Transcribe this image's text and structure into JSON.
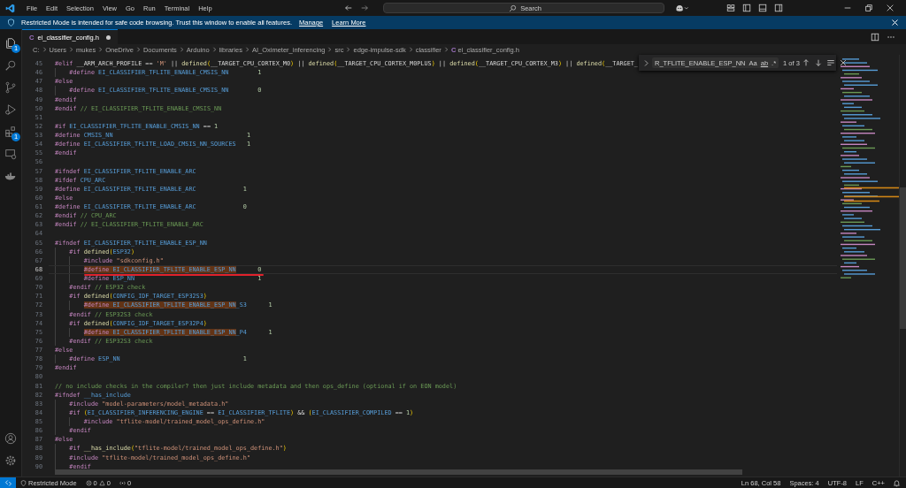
{
  "titlebar": {
    "menu": [
      "File",
      "Edit",
      "Selection",
      "View",
      "Go",
      "Run",
      "Terminal",
      "Help"
    ],
    "search": {
      "placeholder": "Search"
    }
  },
  "banner": {
    "message": "Restricted Mode is intended for safe code browsing. Trust this window to enable all features.",
    "links": [
      "Manage",
      "Learn More"
    ]
  },
  "activity_bar": {
    "items": [
      {
        "kind": "files",
        "badge": "1"
      },
      {
        "kind": "search"
      },
      {
        "kind": "branch"
      },
      {
        "kind": "run"
      },
      {
        "kind": "extensions",
        "badge": "1"
      },
      {
        "kind": "remote"
      },
      {
        "kind": "docker"
      }
    ],
    "bottom": [
      {
        "kind": "account"
      },
      {
        "kind": "settings"
      }
    ]
  },
  "tabs": [
    {
      "icon": "C",
      "label": "ei_classifier_config.h",
      "selected": true,
      "modified": true
    }
  ],
  "breadcrumb": {
    "segments": [
      "C:",
      "Users",
      "mukes",
      "OneDrive",
      "Documents",
      "Arduino",
      "libraries",
      "AI_Oximeter_inferencing",
      "src",
      "edge-impulse-sdk",
      "classifier"
    ],
    "file_icon": "C",
    "file": "ei_classifier_config.h"
  },
  "find": {
    "value": "R_TFLITE_ENABLE_ESP_NN",
    "options": [
      "Aa",
      "ab",
      ".*"
    ],
    "count": "1 of 3"
  },
  "editor": {
    "lines": [
      {
        "number": "45",
        "current": false,
        "underlined": false,
        "tokens": [
          {
            "kind": "pp",
            "text": "#elif"
          },
          {
            "kind": "op",
            "text": " __ARM_ARCH_PROFILE == "
          },
          {
            "kind": "str",
            "text": "'M'"
          },
          {
            "kind": "op",
            "text": " || "
          },
          {
            "kind": "fn",
            "text": "defined"
          },
          {
            "kind": "br",
            "text": "("
          },
          {
            "kind": "op",
            "text": "__TARGET_CPU_CORTEX_M0"
          },
          {
            "kind": "br",
            "text": ")"
          },
          {
            "kind": "op",
            "text": " || "
          },
          {
            "kind": "fn",
            "text": "defined"
          },
          {
            "kind": "br",
            "text": "("
          },
          {
            "kind": "op",
            "text": "__TARGET_CPU_CORTEX_M0PLUS"
          },
          {
            "kind": "br",
            "text": ")"
          },
          {
            "kind": "op",
            "text": " || "
          },
          {
            "kind": "fn",
            "text": "defined"
          },
          {
            "kind": "br",
            "text": "("
          },
          {
            "kind": "op",
            "text": "__TARGET_CPU_CORTEX_M3"
          },
          {
            "kind": "br",
            "text": ")"
          },
          {
            "kind": "op",
            "text": " || "
          },
          {
            "kind": "fn",
            "text": "defined"
          },
          {
            "kind": "br",
            "text": "("
          },
          {
            "kind": "op",
            "text": "__TARGET_"
          }
        ]
      },
      {
        "number": "46",
        "current": false,
        "underlined": false,
        "tokens": [
          {
            "kind": "pp",
            "text": "    #define"
          },
          {
            "kind": "id",
            "text": " EI_CLASSIFIER_TFLITE_ENABLE_CMSIS_NN"
          },
          {
            "kind": "num",
            "text": "        1"
          }
        ]
      },
      {
        "number": "47",
        "current": false,
        "underlined": false,
        "tokens": [
          {
            "kind": "pp",
            "text": "#else"
          }
        ]
      },
      {
        "number": "48",
        "current": false,
        "underlined": false,
        "tokens": [
          {
            "kind": "pp",
            "text": "    #define"
          },
          {
            "kind": "id",
            "text": " EI_CLASSIFIER_TFLITE_ENABLE_CMSIS_NN"
          },
          {
            "kind": "num",
            "text": "        0"
          }
        ]
      },
      {
        "number": "49",
        "current": false,
        "underlined": false,
        "tokens": [
          {
            "kind": "pp",
            "text": "#endif"
          }
        ]
      },
      {
        "number": "50",
        "current": false,
        "underlined": false,
        "tokens": [
          {
            "kind": "pp",
            "text": "#endif"
          },
          {
            "kind": "com",
            "text": " // EI_CLASSIFIER_TFLITE_ENABLE_CMSIS_NN"
          }
        ]
      },
      {
        "number": "51",
        "current": false,
        "underlined": false
      },
      {
        "number": "52",
        "current": false,
        "underlined": false,
        "tokens": [
          {
            "kind": "pp",
            "text": "#if"
          },
          {
            "kind": "id",
            "text": " EI_CLASSIFIER_TFLITE_ENABLE_CMSIS_NN"
          },
          {
            "kind": "op",
            "text": " == "
          },
          {
            "kind": "num",
            "text": "1"
          }
        ]
      },
      {
        "number": "53",
        "current": false,
        "underlined": false,
        "tokens": [
          {
            "kind": "pp",
            "text": "#define"
          },
          {
            "kind": "id",
            "text": " CMSIS_NN"
          },
          {
            "kind": "num",
            "text": "                                     1"
          }
        ]
      },
      {
        "number": "54",
        "current": false,
        "underlined": false,
        "tokens": [
          {
            "kind": "pp",
            "text": "#define"
          },
          {
            "kind": "id",
            "text": " EI_CLASSIFIER_TFLITE_LOAD_CMSIS_NN_SOURCES"
          },
          {
            "kind": "num",
            "text": "   1"
          }
        ]
      },
      {
        "number": "55",
        "current": false,
        "underlined": false,
        "tokens": [
          {
            "kind": "pp",
            "text": "#endif"
          }
        ]
      },
      {
        "number": "56",
        "current": false,
        "underlined": false
      },
      {
        "number": "57",
        "current": false,
        "underlined": false,
        "tokens": [
          {
            "kind": "pp",
            "text": "#ifndef"
          },
          {
            "kind": "id",
            "text": " EI_CLASSIFIER_TFLITE_ENABLE_ARC"
          }
        ]
      },
      {
        "number": "58",
        "current": false,
        "underlined": false,
        "tokens": [
          {
            "kind": "pp",
            "text": "#ifdef"
          },
          {
            "kind": "id",
            "text": " CPU_ARC"
          }
        ]
      },
      {
        "number": "59",
        "current": false,
        "underlined": false,
        "tokens": [
          {
            "kind": "pp",
            "text": "#define"
          },
          {
            "kind": "id",
            "text": " EI_CLASSIFIER_TFLITE_ENABLE_ARC"
          },
          {
            "kind": "num",
            "text": "             1"
          }
        ]
      },
      {
        "number": "60",
        "current": false,
        "underlined": false,
        "tokens": [
          {
            "kind": "pp",
            "text": "#else"
          }
        ]
      },
      {
        "number": "61",
        "current": false,
        "underlined": false,
        "tokens": [
          {
            "kind": "pp",
            "text": "#define"
          },
          {
            "kind": "id",
            "text": " EI_CLASSIFIER_TFLITE_ENABLE_ARC"
          },
          {
            "kind": "num",
            "text": "             0"
          }
        ]
      },
      {
        "number": "62",
        "current": false,
        "underlined": false,
        "tokens": [
          {
            "kind": "pp",
            "text": "#endif"
          },
          {
            "kind": "com",
            "text": " // CPU_ARC"
          }
        ]
      },
      {
        "number": "63",
        "current": false,
        "underlined": false,
        "tokens": [
          {
            "kind": "pp",
            "text": "#endif"
          },
          {
            "kind": "com",
            "text": " // EI_CLASSIFIER_TFLITE_ENABLE_ARC"
          }
        ]
      },
      {
        "number": "64",
        "current": false,
        "underlined": false
      },
      {
        "number": "65",
        "current": false,
        "underlined": false,
        "tokens": [
          {
            "kind": "pp",
            "text": "#ifndef"
          },
          {
            "kind": "id",
            "text": " EI_CLASSIFIER_TFLITE_ENABLE_ESP_NN"
          }
        ]
      },
      {
        "number": "66",
        "current": false,
        "underlined": false,
        "tokens": [
          {
            "kind": "pp",
            "text": "    #if "
          },
          {
            "kind": "fn",
            "text": "defined"
          },
          {
            "kind": "br",
            "text": "("
          },
          {
            "kind": "id",
            "text": "ESP32"
          },
          {
            "kind": "br",
            "text": ")"
          }
        ]
      },
      {
        "number": "67",
        "current": false,
        "underlined": false,
        "tokens": [
          {
            "kind": "pp",
            "text": "        #include"
          },
          {
            "kind": "str",
            "text": " \"sdkconfig.h\""
          }
        ]
      },
      {
        "number": "68",
        "current": true,
        "underlined": true,
        "tokens": [
          {
            "kind": "hitpp",
            "text": "        #define"
          },
          {
            "kind": "hitid",
            "text": " EI_CLASSIFIER_TFLITE_ENABLE_ESP_NN"
          },
          {
            "kind": "num",
            "text": "      0"
          }
        ]
      },
      {
        "number": "69",
        "current": false,
        "underlined": false,
        "tokens": [
          {
            "kind": "pp",
            "text": "        #define"
          },
          {
            "kind": "id",
            "text": " ESP_NN"
          },
          {
            "kind": "num",
            "text": "                                  1"
          }
        ]
      },
      {
        "number": "70",
        "current": false,
        "underlined": false,
        "tokens": [
          {
            "kind": "pp",
            "text": "    #endif"
          },
          {
            "kind": "com",
            "text": " // ESP32 check"
          }
        ]
      },
      {
        "number": "71",
        "current": false,
        "underlined": false,
        "tokens": [
          {
            "kind": "pp",
            "text": "    #if "
          },
          {
            "kind": "fn",
            "text": "defined"
          },
          {
            "kind": "br",
            "text": "("
          },
          {
            "kind": "id",
            "text": "CONFIG_IDF_TARGET_ESP32S3"
          },
          {
            "kind": "br",
            "text": ")"
          }
        ]
      },
      {
        "number": "72",
        "current": false,
        "underlined": false,
        "tokens": [
          {
            "kind": "hitpp",
            "text": "        #define"
          },
          {
            "kind": "hitid",
            "text": " EI_CLASSIFIER_TFLITE_ENABLE_ESP_NN"
          },
          {
            "kind": "id",
            "text": "_S3"
          },
          {
            "kind": "num",
            "text": "      1"
          }
        ]
      },
      {
        "number": "73",
        "current": false,
        "underlined": false,
        "tokens": [
          {
            "kind": "pp",
            "text": "    #endif"
          },
          {
            "kind": "com",
            "text": " // ESP32S3 check"
          }
        ]
      },
      {
        "number": "74",
        "current": false,
        "underlined": false,
        "tokens": [
          {
            "kind": "pp",
            "text": "    #if "
          },
          {
            "kind": "fn",
            "text": "defined"
          },
          {
            "kind": "br",
            "text": "("
          },
          {
            "kind": "id",
            "text": "CONFIG_IDF_TARGET_ESP32P4"
          },
          {
            "kind": "br",
            "text": ")"
          }
        ]
      },
      {
        "number": "75",
        "current": false,
        "underlined": false,
        "tokens": [
          {
            "kind": "hitpp",
            "text": "        #define"
          },
          {
            "kind": "hitid",
            "text": " EI_CLASSIFIER_TFLITE_ENABLE_ESP_NN"
          },
          {
            "kind": "id",
            "text": "_P4"
          },
          {
            "kind": "num",
            "text": "      1"
          }
        ]
      },
      {
        "number": "76",
        "current": false,
        "underlined": false,
        "tokens": [
          {
            "kind": "pp",
            "text": "    #endif"
          },
          {
            "kind": "com",
            "text": " // ESP32S3 check"
          }
        ]
      },
      {
        "number": "77",
        "current": false,
        "underlined": false,
        "tokens": [
          {
            "kind": "pp",
            "text": "#else"
          }
        ]
      },
      {
        "number": "78",
        "current": false,
        "underlined": false,
        "tokens": [
          {
            "kind": "pp",
            "text": "    #define"
          },
          {
            "kind": "id",
            "text": " ESP_NN"
          },
          {
            "kind": "num",
            "text": "                                  1"
          }
        ]
      },
      {
        "number": "79",
        "current": false,
        "underlined": false,
        "tokens": [
          {
            "kind": "pp",
            "text": "#endif"
          }
        ]
      },
      {
        "number": "80",
        "current": false,
        "underlined": false
      },
      {
        "number": "81",
        "current": false,
        "underlined": false,
        "tokens": [
          {
            "kind": "com",
            "text": "// no include checks in the compiler? then just include metadata and then ops_define (optional if on EON model)"
          }
        ]
      },
      {
        "number": "82",
        "current": false,
        "underlined": false,
        "tokens": [
          {
            "kind": "pp",
            "text": "#ifndef"
          },
          {
            "kind": "id",
            "text": " __has_include"
          }
        ]
      },
      {
        "number": "83",
        "current": false,
        "underlined": false,
        "tokens": [
          {
            "kind": "pp",
            "text": "    #include"
          },
          {
            "kind": "str",
            "text": " \"model-parameters/model_metadata.h\""
          }
        ]
      },
      {
        "number": "84",
        "current": false,
        "underlined": false,
        "tokens": [
          {
            "kind": "pp",
            "text": "    #if "
          },
          {
            "kind": "br",
            "text": "("
          },
          {
            "kind": "id",
            "text": "EI_CLASSIFIER_INFERENCING_ENGINE"
          },
          {
            "kind": "op",
            "text": " == "
          },
          {
            "kind": "id",
            "text": "EI_CLASSIFIER_TFLITE"
          },
          {
            "kind": "br",
            "text": ")"
          },
          {
            "kind": "op",
            "text": " && "
          },
          {
            "kind": "br",
            "text": "("
          },
          {
            "kind": "id",
            "text": "EI_CLASSIFIER_COMPILED"
          },
          {
            "kind": "op",
            "text": " == "
          },
          {
            "kind": "num",
            "text": "1"
          },
          {
            "kind": "br",
            "text": ")"
          }
        ]
      },
      {
        "number": "85",
        "current": false,
        "underlined": false,
        "tokens": [
          {
            "kind": "pp",
            "text": "        #include"
          },
          {
            "kind": "str",
            "text": " \"tflite-model/trained_model_ops_define.h\""
          }
        ]
      },
      {
        "number": "86",
        "current": false,
        "underlined": false,
        "tokens": [
          {
            "kind": "pp",
            "text": "    #endif"
          }
        ]
      },
      {
        "number": "87",
        "current": false,
        "underlined": false,
        "tokens": [
          {
            "kind": "pp",
            "text": "#else"
          }
        ]
      },
      {
        "number": "88",
        "current": false,
        "underlined": false,
        "tokens": [
          {
            "kind": "pp",
            "text": "    #if "
          },
          {
            "kind": "fn",
            "text": "__has_include"
          },
          {
            "kind": "br",
            "text": "("
          },
          {
            "kind": "str",
            "text": "\"tflite-model/trained_model_ops_define.h\""
          },
          {
            "kind": "br",
            "text": ")"
          }
        ]
      },
      {
        "number": "89",
        "current": false,
        "underlined": false,
        "tokens": [
          {
            "kind": "pp",
            "text": "    #include"
          },
          {
            "kind": "str",
            "text": " \"tflite-model/trained_model_ops_define.h\""
          }
        ]
      },
      {
        "number": "90",
        "current": false,
        "underlined": false,
        "tokens": [
          {
            "kind": "pp",
            "text": "    #endif"
          }
        ]
      }
    ]
  },
  "status_bar": {
    "mode": "Restricted Mode",
    "errors": "0",
    "warnings": "0",
    "ports": "0",
    "position": "Ln 68, Col 58",
    "indent": "Spaces: 4",
    "encoding": "UTF-8",
    "eol": "LF",
    "language": "C++"
  }
}
